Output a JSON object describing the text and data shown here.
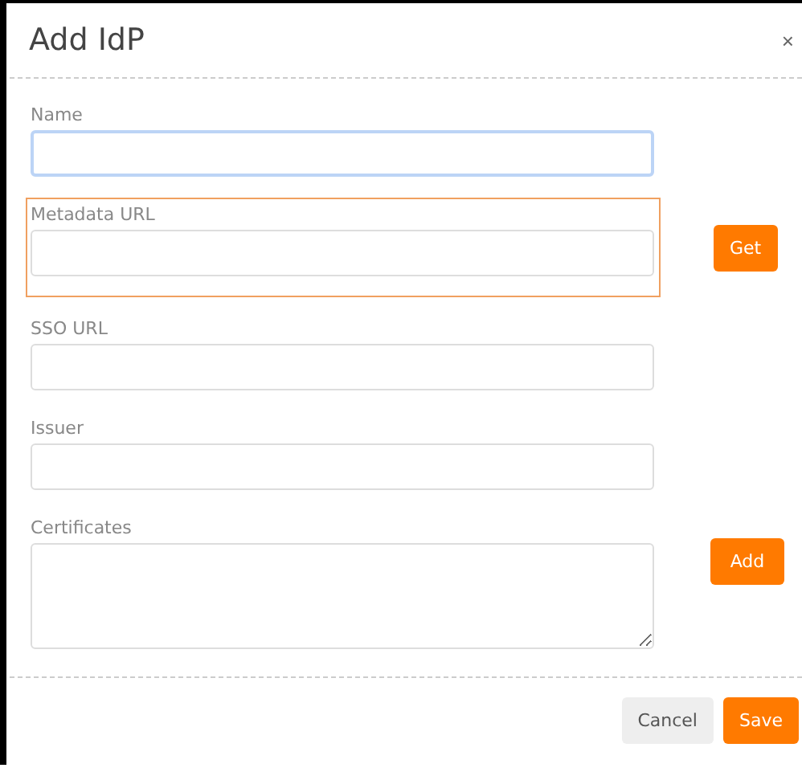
{
  "dialog": {
    "title": "Add IdP",
    "close": "×"
  },
  "fields": [
    {
      "label": "Name",
      "kind": "input",
      "focused": true,
      "highlighted": false
    },
    {
      "label": "Metadata URL",
      "kind": "input",
      "focused": false,
      "highlighted": true,
      "action": "Get"
    },
    {
      "label": "SSO URL",
      "kind": "input",
      "focused": false,
      "highlighted": false
    },
    {
      "label": "Issuer",
      "kind": "input",
      "focused": false,
      "highlighted": false
    },
    {
      "label": "Certificates",
      "kind": "textarea",
      "focused": false,
      "highlighted": false,
      "action": "Add"
    }
  ],
  "buttons": [
    {
      "label": "Cancel",
      "kind": "secondary"
    },
    {
      "label": "Save",
      "kind": "primary"
    }
  ]
}
